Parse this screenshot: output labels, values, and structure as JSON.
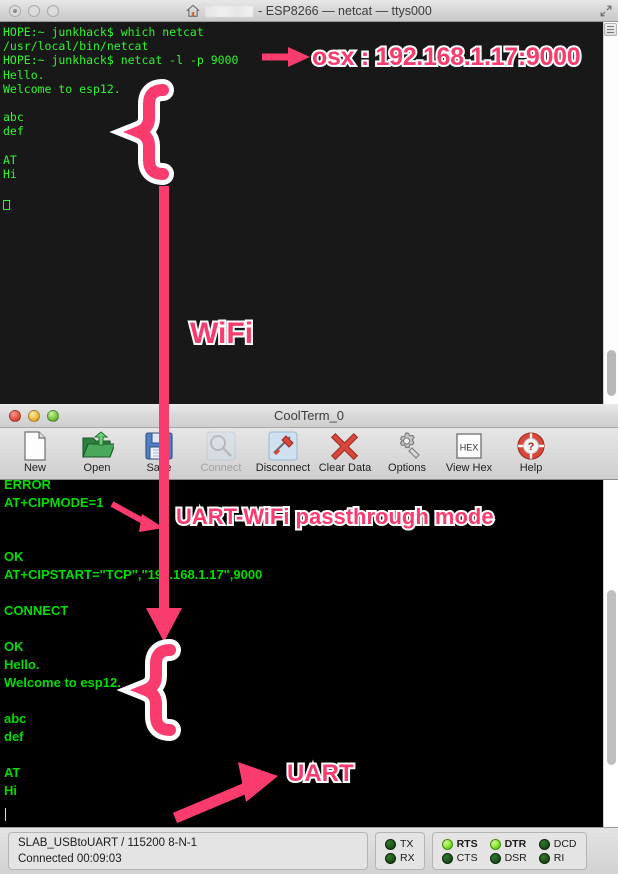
{
  "terminal_window": {
    "title_suffix": "- ESP8266 — netcat — ttys000",
    "home_icon": "home-icon",
    "redacted_label": "",
    "lines": "HOPE:~ junkhack$ which netcat\n/usr/local/bin/netcat\nHOPE:~ junkhack$ netcat -l -p 9000\nHello.\nWelcome to esp12.\n\nabc\ndef\n\nAT\nHi",
    "colors": {
      "background": "#181818",
      "text": "#2ef52e"
    },
    "traffic_lights": [
      "minimize-dot",
      "zoom-dot",
      "close-dot"
    ]
  },
  "coolterm_window": {
    "title": "CoolTerm_0",
    "toolbar": [
      {
        "label": "New",
        "icon": "new-document-icon",
        "disabled": false
      },
      {
        "label": "Open",
        "icon": "open-folder-icon",
        "disabled": false
      },
      {
        "label": "Save",
        "icon": "floppy-disk-icon",
        "disabled": false
      },
      {
        "label": "Connect",
        "icon": "connect-plug-icon",
        "disabled": true
      },
      {
        "label": "Disconnect",
        "icon": "disconnect-icon",
        "disabled": false
      },
      {
        "label": "Clear Data",
        "icon": "red-x-icon",
        "disabled": false
      },
      {
        "label": "Options",
        "icon": "gear-wrench-icon",
        "disabled": false
      },
      {
        "label": "View Hex",
        "icon": "hex-icon",
        "disabled": false
      },
      {
        "label": "Help",
        "icon": "life-ring-help-icon",
        "disabled": false
      }
    ],
    "hex_icon_text": "HEX",
    "lines": "ERROR\nAT+CIPMODE=1\n\n\nOK\nAT+CIPSTART=\"TCP\",\"192.168.1.17\",9000\n\nCONNECT\n\nOK\nHello.\nWelcome to esp12.\n\nabc\ndef\n\nAT\nHi",
    "colors": {
      "background": "#000000",
      "text": "#00dd00"
    },
    "status": {
      "port_line": "SLAB_USBtoUART / 115200 8-N-1",
      "connection_line": "Connected 00:09:03",
      "leds": [
        {
          "label": "TX",
          "on": false
        },
        {
          "label": "RX",
          "on": false
        },
        {
          "label": "RTS",
          "on": true
        },
        {
          "label": "CTS",
          "on": false
        },
        {
          "label": "DTR",
          "on": true
        },
        {
          "label": "DSR",
          "on": false
        },
        {
          "label": "DCD",
          "on": false
        },
        {
          "label": "RI",
          "on": false
        }
      ]
    }
  },
  "annotations": {
    "color": "#fa3b6d",
    "outline_color": "#ffffff",
    "osx": "osx : 192.168.1.17:9000",
    "wifi": "WiFi",
    "passthrough": "UART-WiFi passthrough mode",
    "uart": "UART"
  }
}
